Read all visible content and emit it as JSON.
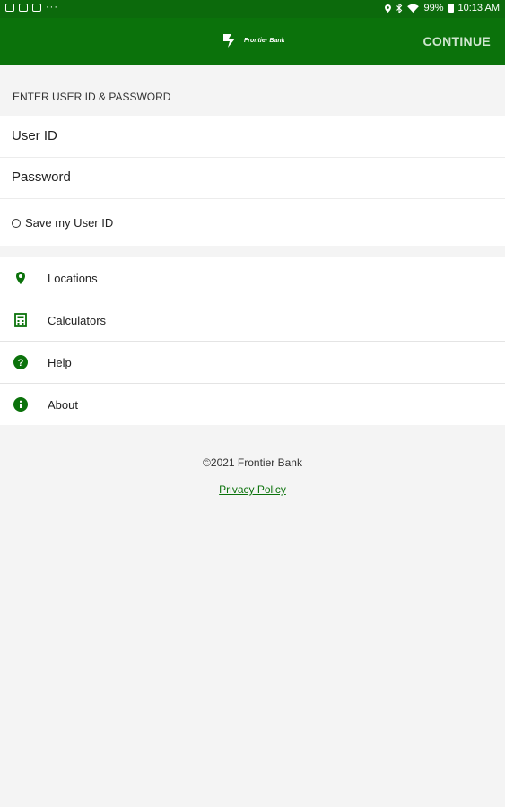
{
  "status_bar": {
    "battery": "99%",
    "time": "10:13 AM",
    "left_icons": [
      "gallery-icon",
      "photo-icon",
      "message-icon"
    ],
    "overflow": "···"
  },
  "app_bar": {
    "logo_text": "Frontier Bank",
    "continue_label": "CONTINUE",
    "color": "#0b720b"
  },
  "login": {
    "section_title": "ENTER USER ID & PASSWORD",
    "user_id_label": "User ID",
    "password_label": "Password",
    "save_user_id_label": "Save my User ID",
    "save_user_id_checked": false
  },
  "menu": {
    "items": [
      {
        "label": "Locations",
        "icon": "location-pin-icon"
      },
      {
        "label": "Calculators",
        "icon": "calculator-icon"
      },
      {
        "label": "Help",
        "icon": "help-icon"
      },
      {
        "label": "About",
        "icon": "info-icon"
      }
    ]
  },
  "footer": {
    "copyright": "©2021 Frontier Bank",
    "privacy_policy": "Privacy Policy"
  }
}
